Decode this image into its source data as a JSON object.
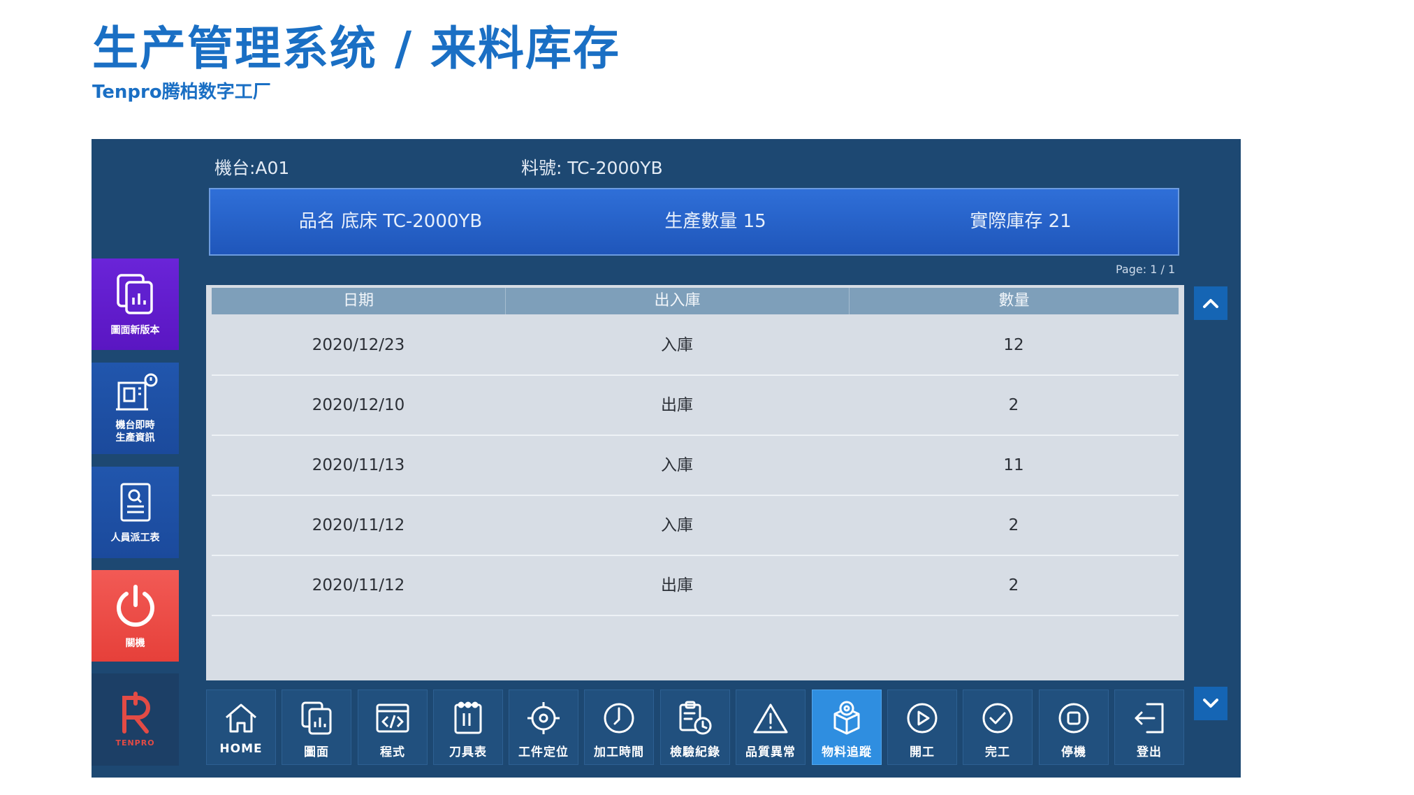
{
  "page": {
    "title": "生产管理系统 / 来料库存",
    "subtitle": "Tenpro腾柏数字工厂"
  },
  "header": {
    "machine": "機台:A01",
    "part_no": "料號: TC-2000YB"
  },
  "product": {
    "name": "品名 底床 TC-2000YB",
    "production_qty": "生產數量 15",
    "actual_stock": "實際庫存 21"
  },
  "pagination": {
    "label": "Page: 1 / 1"
  },
  "sidebar": {
    "items": [
      {
        "label": "圖面新版本",
        "icon": "drawing-icon"
      },
      {
        "label": "機台即時\n生產資訊",
        "icon": "machine-info-icon"
      },
      {
        "label": "人員派工表",
        "icon": "assignment-icon"
      },
      {
        "label": "關機",
        "icon": "power-icon"
      },
      {
        "label": "TENPRO",
        "icon": "tenpro-logo"
      }
    ]
  },
  "table": {
    "headers": [
      "日期",
      "出入庫",
      "數量"
    ],
    "rows": [
      [
        "2020/12/23",
        "入庫",
        "12"
      ],
      [
        "2020/12/10",
        "出庫",
        "2"
      ],
      [
        "2020/11/13",
        "入庫",
        "11"
      ],
      [
        "2020/11/12",
        "入庫",
        "2"
      ],
      [
        "2020/11/12",
        "出庫",
        "2"
      ]
    ]
  },
  "toolbar": {
    "items": [
      {
        "label": "HOME",
        "icon": "home-icon"
      },
      {
        "label": "圖面",
        "icon": "drawing-icon"
      },
      {
        "label": "程式",
        "icon": "code-icon"
      },
      {
        "label": "刀具表",
        "icon": "tool-list-icon"
      },
      {
        "label": "工件定位",
        "icon": "crosshair-icon"
      },
      {
        "label": "加工時間",
        "icon": "clock-icon"
      },
      {
        "label": "檢驗紀錄",
        "icon": "clipboard-clock-icon"
      },
      {
        "label": "品質異常",
        "icon": "warning-icon"
      },
      {
        "label": "物料追蹤",
        "icon": "material-box-icon"
      },
      {
        "label": "開工",
        "icon": "play-icon"
      },
      {
        "label": "完工",
        "icon": "check-circle-icon"
      },
      {
        "label": "停機",
        "icon": "stop-icon"
      },
      {
        "label": "登出",
        "icon": "logout-icon"
      }
    ],
    "active_index": 8
  },
  "colors": {
    "title_blue": "#1a6fc4",
    "panel_navy": "#1d4872",
    "active_button": "#2f8ee0",
    "power_red": "#e6403a",
    "purple_button": "#6a24d8"
  }
}
